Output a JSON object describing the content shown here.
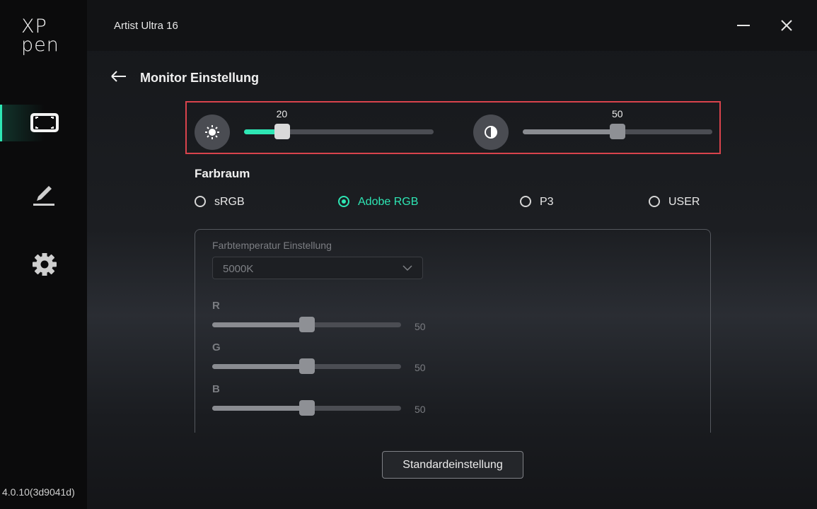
{
  "sidebar": {
    "logo_top": "XP",
    "logo_bottom": "pen",
    "items": [
      {
        "name": "display-icon",
        "active": true
      },
      {
        "name": "pen-icon",
        "active": false
      },
      {
        "name": "gear-icon",
        "active": false
      }
    ],
    "version": "4.0.10(3d9041d)"
  },
  "header": {
    "title": "Artist Ultra 16",
    "minimize_icon": "minimize-icon",
    "close_icon": "close-icon"
  },
  "page": {
    "back_icon": "arrow-left-icon",
    "title": "Monitor Einstellung"
  },
  "brightness": {
    "icon": "sun-icon",
    "value": "20",
    "level": 20
  },
  "contrast": {
    "icon": "contrast-icon",
    "value": "50",
    "level": 50
  },
  "colorspace": {
    "label": "Farbraum",
    "options": [
      {
        "label": "sRGB",
        "selected": false
      },
      {
        "label": "Adobe RGB",
        "selected": true
      },
      {
        "label": "P3",
        "selected": false
      },
      {
        "label": "USER",
        "selected": false
      }
    ]
  },
  "color_temperature": {
    "label": "Farbtemperatur Einstellung",
    "selected": "5000K"
  },
  "channels": [
    {
      "label": "R",
      "value": "50",
      "level": 50
    },
    {
      "label": "G",
      "value": "50",
      "level": 50
    },
    {
      "label": "B",
      "value": "50",
      "level": 50
    }
  ],
  "reset_button": "Standardeinstellung",
  "colors": {
    "accent": "#2ee6b4",
    "highlight_border": "#d9434c"
  }
}
